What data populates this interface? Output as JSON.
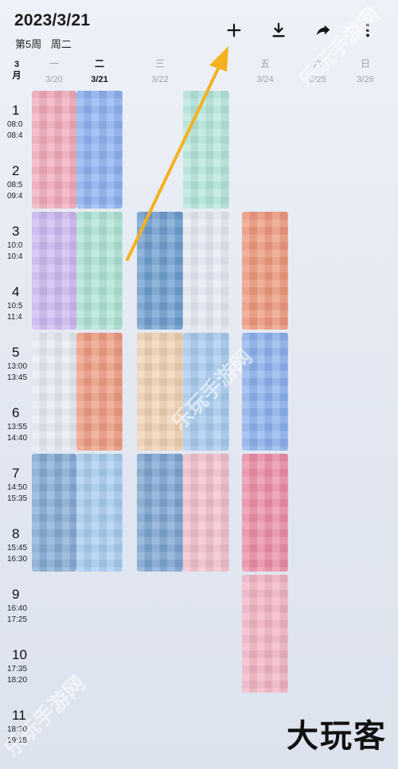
{
  "header": {
    "date": "2023/3/21",
    "week_number": "第5周",
    "weekday": "周二"
  },
  "toolbar": {
    "buttons": [
      {
        "name": "add",
        "icon": "plus-icon"
      },
      {
        "name": "download",
        "icon": "download-icon"
      },
      {
        "name": "share",
        "icon": "share-icon"
      },
      {
        "name": "more",
        "icon": "more-vertical-icon"
      }
    ]
  },
  "month": {
    "value": "3",
    "unit": "月"
  },
  "days": [
    {
      "weekday": "一",
      "date": "3/20",
      "today": false
    },
    {
      "weekday": "二",
      "date": "3/21",
      "today": true
    },
    {
      "weekday": "三",
      "date": "3/22",
      "today": false
    },
    {
      "weekday": "",
      "date": "",
      "today": false
    },
    {
      "weekday": "五",
      "date": "3/24",
      "today": false
    },
    {
      "weekday": "六",
      "date": "3/25",
      "today": false
    },
    {
      "weekday": "日",
      "date": "3/26",
      "today": false
    }
  ],
  "periods": [
    {
      "num": "1",
      "start": "08:0",
      "end": "08:4"
    },
    {
      "num": "2",
      "start": "08:5",
      "end": "09:4"
    },
    {
      "num": "3",
      "start": "10:0",
      "end": "10:4"
    },
    {
      "num": "4",
      "start": "10:5",
      "end": "11:4"
    },
    {
      "num": "5",
      "start": "13:00",
      "end": "13:45"
    },
    {
      "num": "6",
      "start": "13:55",
      "end": "14:40"
    },
    {
      "num": "7",
      "start": "14:50",
      "end": "15:35"
    },
    {
      "num": "8",
      "start": "15:45",
      "end": "16:30"
    },
    {
      "num": "9",
      "start": "16:40",
      "end": "17:25"
    },
    {
      "num": "10",
      "start": "17:35",
      "end": "18:20"
    },
    {
      "num": "11",
      "start": "18:30",
      "end": "19:15"
    }
  ],
  "courses": [
    {
      "day": 0,
      "start": 1,
      "span": 2,
      "color": "#f2aabb"
    },
    {
      "day": 1,
      "start": 1,
      "span": 2,
      "color": "#8fb2f2"
    },
    {
      "day": 3,
      "start": 1,
      "span": 2,
      "color": "#b5e6dc"
    },
    {
      "day": 0,
      "start": 3,
      "span": 2,
      "color": "#cdb9f2"
    },
    {
      "day": 1,
      "start": 3,
      "span": 2,
      "color": "#aee3d6"
    },
    {
      "day": 2,
      "start": 3,
      "span": 2,
      "color": "#6f9fd0"
    },
    {
      "day": 3,
      "start": 3,
      "span": 2,
      "color": "#e6e9f4"
    },
    {
      "day": 4,
      "start": 3,
      "span": 2,
      "color": "#ee9a7e"
    },
    {
      "day": 0,
      "start": 5,
      "span": 2,
      "color": "#e7eaf3"
    },
    {
      "day": 1,
      "start": 5,
      "span": 2,
      "color": "#ee9d83"
    },
    {
      "day": 2,
      "start": 5,
      "span": 2,
      "color": "#f0d2b4"
    },
    {
      "day": 3,
      "start": 5,
      "span": 2,
      "color": "#a8ccf0"
    },
    {
      "day": 4,
      "start": 5,
      "span": 2,
      "color": "#8db3ee"
    },
    {
      "day": 0,
      "start": 7,
      "span": 2,
      "color": "#86acd6"
    },
    {
      "day": 1,
      "start": 7,
      "span": 2,
      "color": "#a8cdf0"
    },
    {
      "day": 2,
      "start": 7,
      "span": 2,
      "color": "#7ea6d2"
    },
    {
      "day": 3,
      "start": 7,
      "span": 2,
      "color": "#f2c0cc"
    },
    {
      "day": 4,
      "start": 7,
      "span": 2,
      "color": "#ec8ea7"
    },
    {
      "day": 4,
      "start": 9,
      "span": 2,
      "color": "#f2b6c4"
    }
  ],
  "watermark": {
    "logo": "大玩客",
    "site": "乐玩手游网"
  }
}
